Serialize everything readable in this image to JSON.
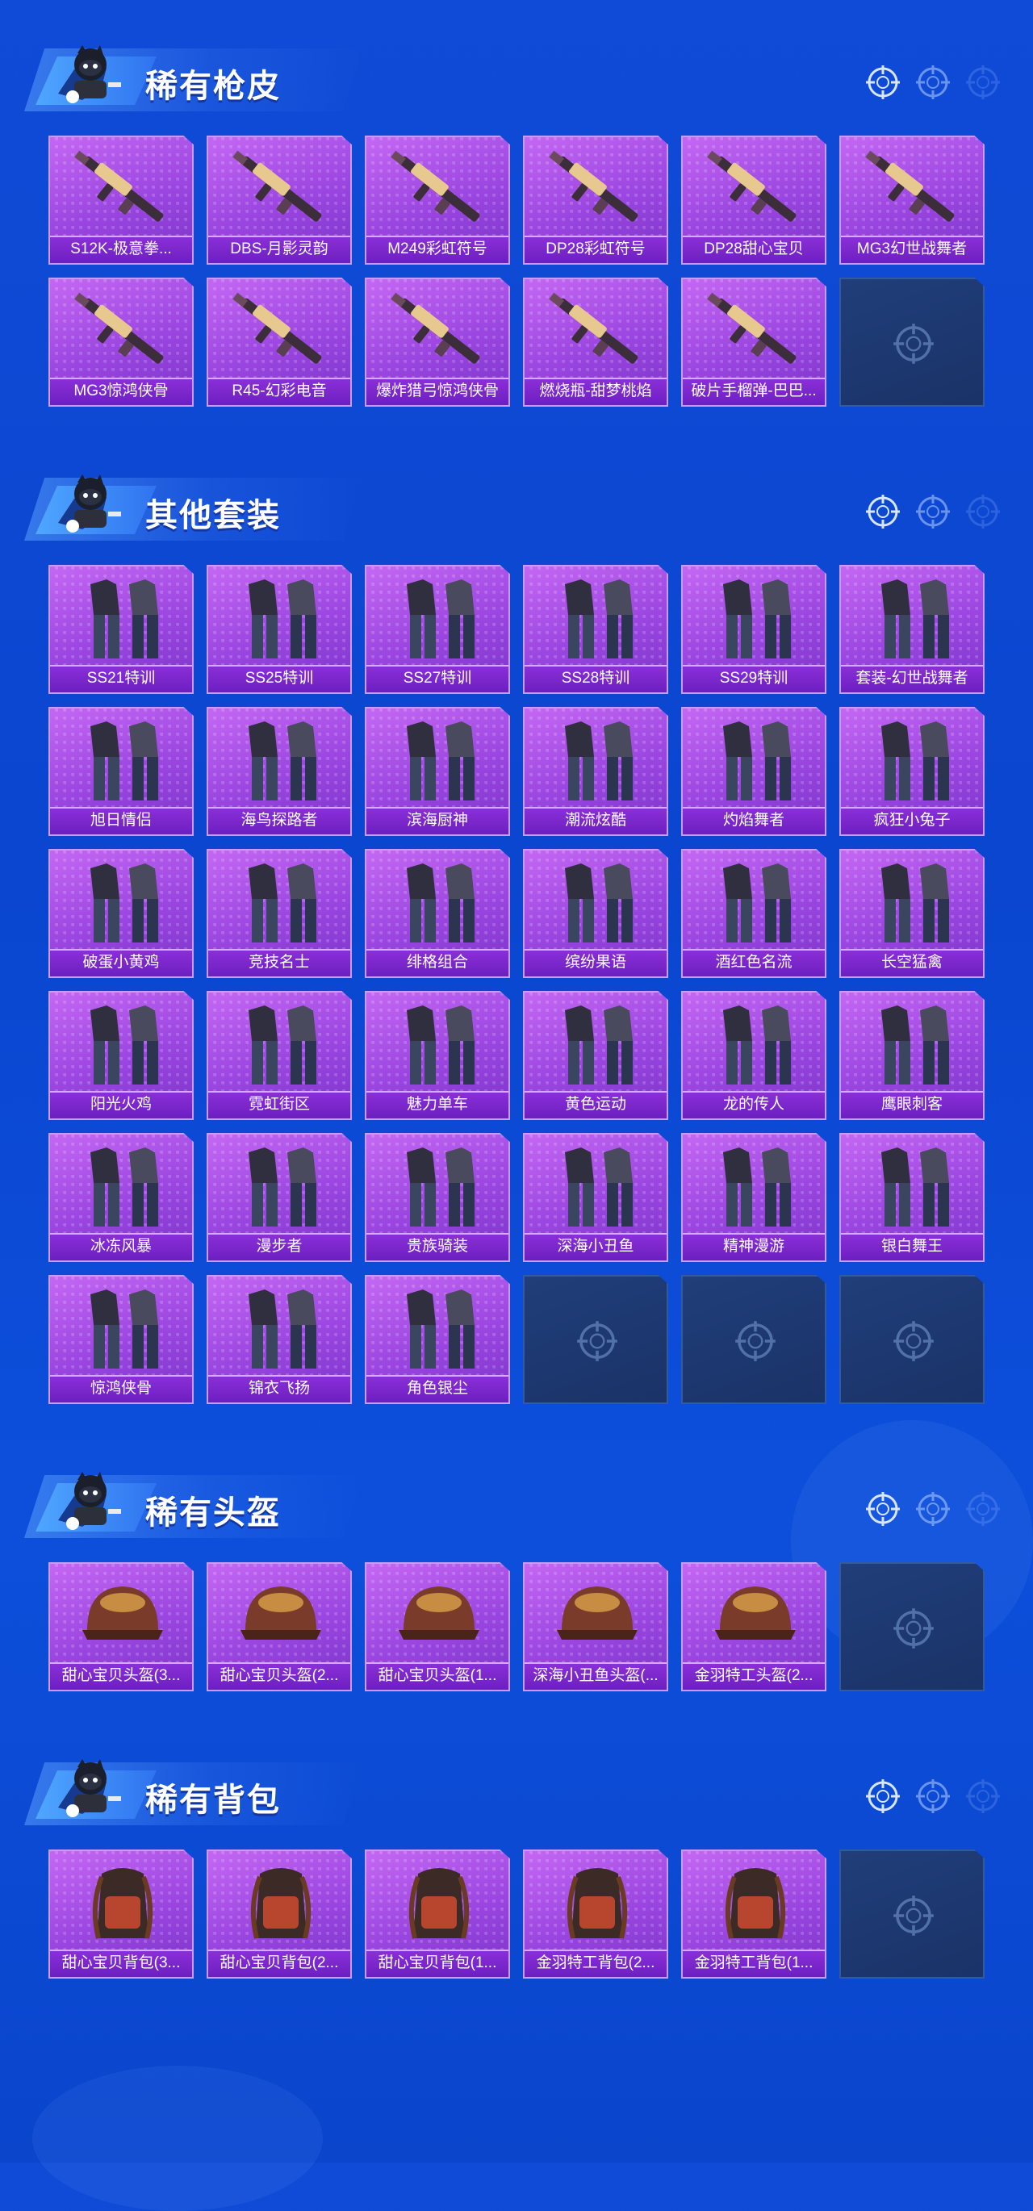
{
  "sections": [
    {
      "title": "稀有枪皮",
      "items": [
        {
          "label": "S12K-极意拳..."
        },
        {
          "label": "DBS-月影灵韵"
        },
        {
          "label": "M249彩虹符号"
        },
        {
          "label": "DP28彩虹符号"
        },
        {
          "label": "DP28甜心宝贝"
        },
        {
          "label": "MG3幻世战舞者"
        },
        {
          "label": "MG3惊鸿侠骨"
        },
        {
          "label": "R45-幻彩电音"
        },
        {
          "label": "爆炸猎弓惊鸿侠骨"
        },
        {
          "label": "燃烧瓶-甜梦桃焰"
        },
        {
          "label": "破片手榴弹-巴巴..."
        }
      ],
      "empty_slots": 1
    },
    {
      "title": "其他套装",
      "items": [
        {
          "label": "SS21特训"
        },
        {
          "label": "SS25特训"
        },
        {
          "label": "SS27特训"
        },
        {
          "label": "SS28特训"
        },
        {
          "label": "SS29特训"
        },
        {
          "label": "套装-幻世战舞者"
        },
        {
          "label": "旭日情侣"
        },
        {
          "label": "海鸟探路者"
        },
        {
          "label": "滨海厨神"
        },
        {
          "label": "潮流炫酷"
        },
        {
          "label": "灼焰舞者"
        },
        {
          "label": "疯狂小兔子"
        },
        {
          "label": "破蛋小黄鸡"
        },
        {
          "label": "竞技名士"
        },
        {
          "label": "绯格组合"
        },
        {
          "label": "缤纷果语"
        },
        {
          "label": "酒红色名流"
        },
        {
          "label": "长空猛禽"
        },
        {
          "label": "阳光火鸡"
        },
        {
          "label": "霓虹街区"
        },
        {
          "label": "魅力单车"
        },
        {
          "label": "黄色运动"
        },
        {
          "label": "龙的传人"
        },
        {
          "label": "鹰眼刺客"
        },
        {
          "label": "冰冻风暴"
        },
        {
          "label": "漫步者"
        },
        {
          "label": "贵族骑装"
        },
        {
          "label": "深海小丑鱼"
        },
        {
          "label": "精神漫游"
        },
        {
          "label": "银白舞王"
        },
        {
          "label": "惊鸿侠骨"
        },
        {
          "label": "锦衣飞扬"
        },
        {
          "label": "角色银尘"
        }
      ],
      "empty_slots": 3
    },
    {
      "title": "稀有头盔",
      "items": [
        {
          "label": "甜心宝贝头盔(3..."
        },
        {
          "label": "甜心宝贝头盔(2..."
        },
        {
          "label": "甜心宝贝头盔(1..."
        },
        {
          "label": "深海小丑鱼头盔(..."
        },
        {
          "label": "金羽特工头盔(2..."
        }
      ],
      "empty_slots": 1
    },
    {
      "title": "稀有背包",
      "items": [
        {
          "label": "甜心宝贝背包(3..."
        },
        {
          "label": "甜心宝贝背包(2..."
        },
        {
          "label": "甜心宝贝背包(1..."
        },
        {
          "label": "金羽特工背包(2..."
        },
        {
          "label": "金羽特工背包(1..."
        }
      ],
      "empty_slots": 1
    }
  ],
  "colors": {
    "card_purple": "#a24ee3",
    "label_bar": "#7a26cc",
    "empty_slot": "#1d3a72",
    "background": "#0c4ad4"
  },
  "icons": [
    "mascot-icon",
    "crosshair-icon"
  ]
}
